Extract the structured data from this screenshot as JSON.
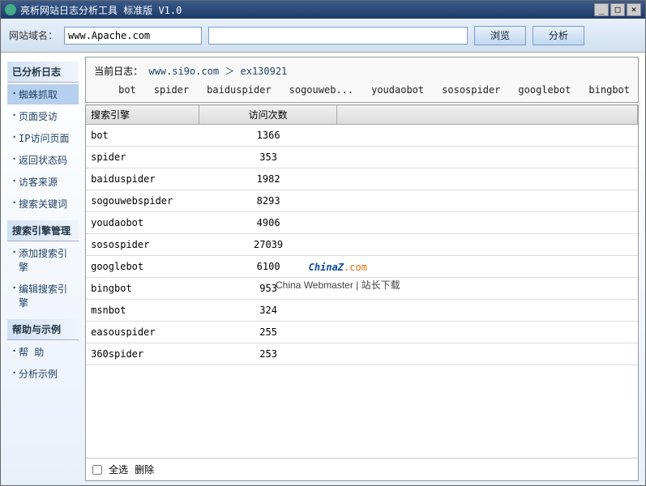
{
  "titlebar": {
    "title": "亮析网站日志分析工具 标准版 V1.0"
  },
  "toolbar": {
    "domain_label": "网站域名：",
    "domain_value": "www.Apache.com",
    "browse": "浏览",
    "analyze": "分析"
  },
  "sidebar": {
    "g1": "已分析日志",
    "g1_items": [
      "蜘蛛抓取",
      "页面受访",
      "IP访问页面",
      "返回状态码",
      "访客来源",
      "搜索关键词"
    ],
    "g2": "搜索引擎管理",
    "g2_items": [
      "添加搜索引擎",
      "编辑搜索引擎"
    ],
    "g3": "帮助与示例",
    "g3_items": [
      "帮 助",
      "分析示例"
    ]
  },
  "loghead": {
    "label": "当前日志：",
    "path": "www.si9o.com ＞ ex130921",
    "tabs": [
      "bot",
      "spider",
      "baiduspider",
      "sogouweb...",
      "youdaobot",
      "sosospider",
      "googlebot",
      "bingbot"
    ]
  },
  "table": {
    "cols": [
      "搜索引擎",
      "访问次数"
    ],
    "rows": [
      {
        "name": "bot",
        "count": "1366"
      },
      {
        "name": "spider",
        "count": "353"
      },
      {
        "name": "baiduspider",
        "count": "1982"
      },
      {
        "name": "sogouwebspider",
        "count": "8293"
      },
      {
        "name": "youdaobot",
        "count": "4906"
      },
      {
        "name": "sosospider",
        "count": "27039"
      },
      {
        "name": "googlebot",
        "count": "6100"
      },
      {
        "name": "bingbot",
        "count": "953"
      },
      {
        "name": "msnbot",
        "count": "324"
      },
      {
        "name": "easouspider",
        "count": "255"
      },
      {
        "name": "360spider",
        "count": "253"
      }
    ]
  },
  "footer": {
    "selectall": "全选",
    "delete": "删除"
  },
  "watermark": {
    "main": "ChinaZ",
    "dotcom": ".com",
    "sub": "China Webmaster | 站长下载"
  }
}
